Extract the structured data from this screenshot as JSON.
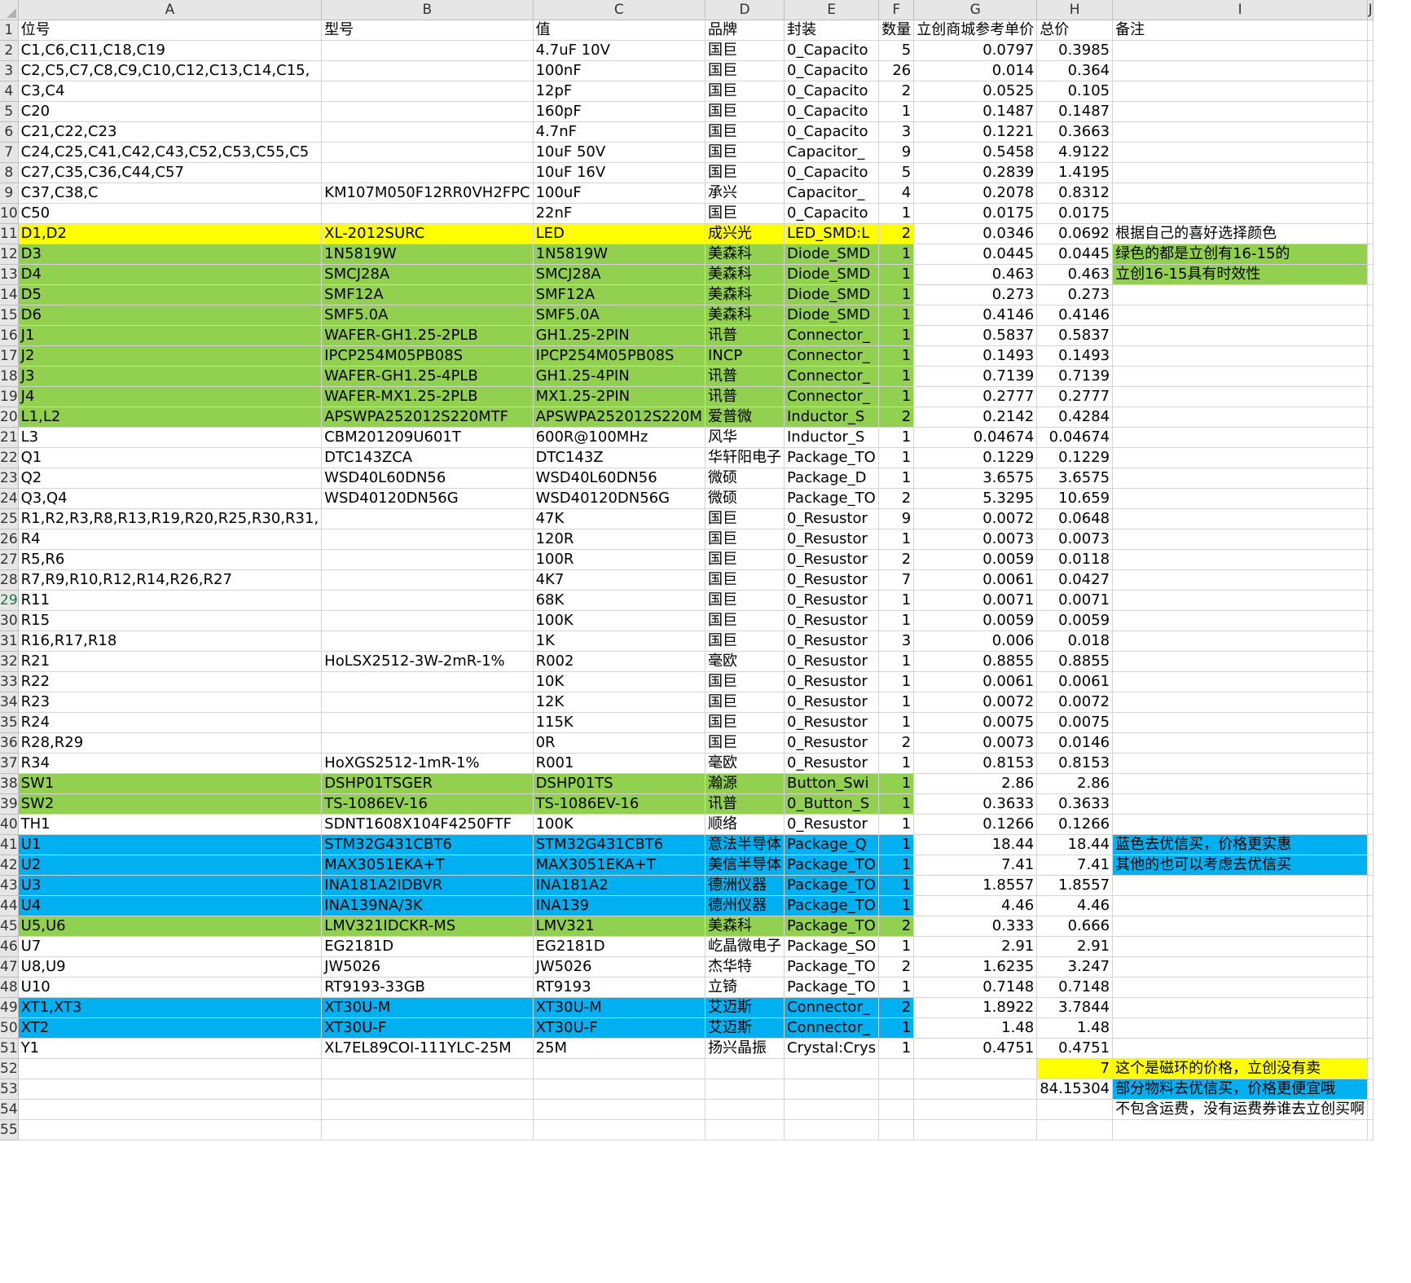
{
  "colors": {
    "yellow": "#ffff00",
    "green": "#92d050",
    "blue": "#00b0f0",
    "header_bg": "#e6e6e6"
  },
  "column_headers": [
    "A",
    "B",
    "C",
    "D",
    "E",
    "F",
    "G",
    "H",
    "I",
    "J"
  ],
  "rows": [
    {
      "r": 1,
      "cells": [
        "位号",
        "型号",
        "值",
        "品牌",
        "封装",
        "数量",
        "立创商城参考单价",
        "总价",
        "备注",
        ""
      ]
    },
    {
      "r": 2,
      "cells": [
        "C1,C6,C11,C18,C19",
        "",
        "4.7uF 10V",
        "国巨",
        "0_Capacito",
        "5",
        "0.0797",
        "0.3985",
        "",
        ""
      ]
    },
    {
      "r": 3,
      "cells": [
        "C2,C5,C7,C8,C9,C10,C12,C13,C14,C15,",
        "",
        "100nF",
        "国巨",
        "0_Capacito",
        "26",
        "0.014",
        "0.364",
        "",
        ""
      ]
    },
    {
      "r": 4,
      "cells": [
        "C3,C4",
        "",
        "12pF",
        "国巨",
        "0_Capacito",
        "2",
        "0.0525",
        "0.105",
        "",
        ""
      ]
    },
    {
      "r": 5,
      "cells": [
        "C20",
        "",
        "160pF",
        "国巨",
        "0_Capacito",
        "1",
        "0.1487",
        "0.1487",
        "",
        ""
      ]
    },
    {
      "r": 6,
      "cells": [
        "C21,C22,C23",
        "",
        "4.7nF",
        "国巨",
        "0_Capacito",
        "3",
        "0.1221",
        "0.3663",
        "",
        ""
      ]
    },
    {
      "r": 7,
      "cells": [
        "C24,C25,C41,C42,C43,C52,C53,C55,C5",
        "",
        "10uF 50V",
        "国巨",
        "Capacitor_",
        "9",
        "0.5458",
        "4.9122",
        "",
        ""
      ]
    },
    {
      "r": 8,
      "cells": [
        "C27,C35,C36,C44,C57",
        "",
        "10uF 16V",
        "国巨",
        "0_Capacito",
        "5",
        "0.2839",
        "1.4195",
        "",
        ""
      ]
    },
    {
      "r": 9,
      "cells": [
        "C37,C38,C",
        "KM107M050F12RR0VH2FPC",
        "100uF",
        "承兴",
        "Capacitor_",
        "4",
        "0.2078",
        "0.8312",
        "",
        ""
      ]
    },
    {
      "r": 10,
      "cells": [
        "C50",
        "",
        "22nF",
        "国巨",
        "0_Capacito",
        "1",
        "0.0175",
        "0.0175",
        "",
        ""
      ]
    },
    {
      "r": 11,
      "cells": [
        "D1,D2",
        "XL-2012SURC",
        "LED",
        "成兴光",
        "LED_SMD:L",
        "2",
        "0.0346",
        "0.0692",
        "根据自己的喜好选择颜色",
        ""
      ]
    },
    {
      "r": 12,
      "cells": [
        "D3",
        "1N5819W",
        "1N5819W",
        "美森科",
        "Diode_SMD",
        "1",
        "0.0445",
        "0.0445",
        "绿色的都是立创有16-15的",
        ""
      ]
    },
    {
      "r": 13,
      "cells": [
        "D4",
        "SMCJ28A",
        "SMCJ28A",
        "美森科",
        "Diode_SMD",
        "1",
        "0.463",
        "0.463",
        "立创16-15具有时效性",
        ""
      ]
    },
    {
      "r": 14,
      "cells": [
        "D5",
        "SMF12A",
        "SMF12A",
        "美森科",
        "Diode_SMD",
        "1",
        "0.273",
        "0.273",
        "",
        ""
      ]
    },
    {
      "r": 15,
      "cells": [
        "D6",
        "SMF5.0A",
        "SMF5.0A",
        "美森科",
        "Diode_SMD",
        "1",
        "0.4146",
        "0.4146",
        "",
        ""
      ]
    },
    {
      "r": 16,
      "cells": [
        "J1",
        "WAFER-GH1.25-2PLB",
        "GH1.25-2PIN",
        "讯普",
        "Connector_",
        "1",
        "0.5837",
        "0.5837",
        "",
        ""
      ]
    },
    {
      "r": 17,
      "cells": [
        "J2",
        "IPCP254M05PB08S",
        "IPCP254M05PB08S",
        "INCP",
        "Connector_",
        "1",
        "0.1493",
        "0.1493",
        "",
        ""
      ]
    },
    {
      "r": 18,
      "cells": [
        "J3",
        "WAFER-GH1.25-4PLB",
        "GH1.25-4PIN",
        "讯普",
        "Connector_",
        "1",
        "0.7139",
        "0.7139",
        "",
        ""
      ]
    },
    {
      "r": 19,
      "cells": [
        "J4",
        "WAFER-MX1.25-2PLB",
        "MX1.25-2PIN",
        "讯普",
        "Connector_",
        "1",
        "0.2777",
        "0.2777",
        "",
        ""
      ]
    },
    {
      "r": 20,
      "cells": [
        "L1,L2",
        "APSWPA252012S220MTF",
        "APSWPA252012S220M",
        "爱普微",
        "Inductor_S",
        "2",
        "0.2142",
        "0.4284",
        "",
        ""
      ]
    },
    {
      "r": 21,
      "cells": [
        "L3",
        "CBM201209U601T",
        "600R@100MHz",
        "风华",
        "Inductor_S",
        "1",
        "0.04674",
        "0.04674",
        "",
        ""
      ]
    },
    {
      "r": 22,
      "cells": [
        "Q1",
        "DTC143ZCA",
        "DTC143Z",
        "华轩阳电子",
        "Package_TO",
        "1",
        "0.1229",
        "0.1229",
        "",
        ""
      ]
    },
    {
      "r": 23,
      "cells": [
        "Q2",
        "WSD40L60DN56",
        "WSD40L60DN56",
        "微硕",
        "Package_D",
        "1",
        "3.6575",
        "3.6575",
        "",
        ""
      ]
    },
    {
      "r": 24,
      "cells": [
        "Q3,Q4",
        "WSD40120DN56G",
        "WSD40120DN56G",
        "微硕",
        "Package_TO",
        "2",
        "5.3295",
        "10.659",
        "",
        ""
      ]
    },
    {
      "r": 25,
      "cells": [
        "R1,R2,R3,R8,R13,R19,R20,R25,R30,R31,",
        "",
        "47K",
        "国巨",
        "0_Resustor",
        "9",
        "0.0072",
        "0.0648",
        "",
        ""
      ]
    },
    {
      "r": 26,
      "cells": [
        "R4",
        "",
        "120R",
        "国巨",
        "0_Resustor",
        "1",
        "0.0073",
        "0.0073",
        "",
        ""
      ]
    },
    {
      "r": 27,
      "cells": [
        "R5,R6",
        "",
        "100R",
        "国巨",
        "0_Resustor",
        "2",
        "0.0059",
        "0.0118",
        "",
        ""
      ]
    },
    {
      "r": 28,
      "cells": [
        "R7,R9,R10,R12,R14,R26,R27",
        "",
        "4K7",
        "国巨",
        "0_Resustor",
        "7",
        "0.0061",
        "0.0427",
        "",
        ""
      ]
    },
    {
      "r": 29,
      "cells": [
        "R11",
        "",
        "68K",
        "国巨",
        "0_Resustor",
        "1",
        "0.0071",
        "0.0071",
        "",
        ""
      ]
    },
    {
      "r": 30,
      "cells": [
        "R15",
        "",
        "100K",
        "国巨",
        "0_Resustor",
        "1",
        "0.0059",
        "0.0059",
        "",
        ""
      ]
    },
    {
      "r": 31,
      "cells": [
        "R16,R17,R18",
        "",
        "1K",
        "国巨",
        "0_Resustor",
        "3",
        "0.006",
        "0.018",
        "",
        ""
      ]
    },
    {
      "r": 32,
      "cells": [
        "R21",
        "HoLSX2512-3W-2mR-1%",
        "R002",
        "毫欧",
        "0_Resustor",
        "1",
        "0.8855",
        "0.8855",
        "",
        ""
      ]
    },
    {
      "r": 33,
      "cells": [
        "R22",
        "",
        "10K",
        "国巨",
        "0_Resustor",
        "1",
        "0.0061",
        "0.0061",
        "",
        ""
      ]
    },
    {
      "r": 34,
      "cells": [
        "R23",
        "",
        "12K",
        "国巨",
        "0_Resustor",
        "1",
        "0.0072",
        "0.0072",
        "",
        ""
      ]
    },
    {
      "r": 35,
      "cells": [
        "R24",
        "",
        "115K",
        "国巨",
        "0_Resustor",
        "1",
        "0.0075",
        "0.0075",
        "",
        ""
      ]
    },
    {
      "r": 36,
      "cells": [
        "R28,R29",
        "",
        "0R",
        "国巨",
        "0_Resustor",
        "2",
        "0.0073",
        "0.0146",
        "",
        ""
      ]
    },
    {
      "r": 37,
      "cells": [
        "R34",
        "HoXGS2512-1mR-1%",
        "R001",
        "毫欧",
        "0_Resustor",
        "1",
        "0.8153",
        "0.8153",
        "",
        ""
      ]
    },
    {
      "r": 38,
      "cells": [
        "SW1",
        "DSHP01TSGER",
        "DSHP01TS",
        "瀚源",
        "Button_Swi",
        "1",
        "2.86",
        "2.86",
        "",
        ""
      ]
    },
    {
      "r": 39,
      "cells": [
        "SW2",
        "TS-1086EV-16",
        "TS-1086EV-16",
        "讯普",
        "0_Button_S",
        "1",
        "0.3633",
        "0.3633",
        "",
        ""
      ]
    },
    {
      "r": 40,
      "cells": [
        "TH1",
        "SDNT1608X104F4250FTF",
        "100K",
        "顺络",
        "0_Resustor",
        "1",
        "0.1266",
        "0.1266",
        "",
        ""
      ]
    },
    {
      "r": 41,
      "cells": [
        "U1",
        "STM32G431CBT6",
        "STM32G431CBT6",
        "意法半导体",
        "Package_Q",
        "1",
        "18.44",
        "18.44",
        "蓝色去优信买，价格更实惠",
        ""
      ]
    },
    {
      "r": 42,
      "cells": [
        "U2",
        "MAX3051EKA+T",
        "MAX3051EKA+T",
        "美信半导体",
        "Package_TO",
        "1",
        "7.41",
        "7.41",
        "其他的也可以考虑去优信买",
        ""
      ]
    },
    {
      "r": 43,
      "cells": [
        "U3",
        "INA181A2IDBVR",
        "INA181A2",
        "德洲仪器",
        "Package_TO",
        "1",
        "1.8557",
        "1.8557",
        "",
        ""
      ]
    },
    {
      "r": 44,
      "cells": [
        "U4",
        "INA139NA/3K",
        "INA139",
        "德州仪器",
        "Package_TO",
        "1",
        "4.46",
        "4.46",
        "",
        ""
      ]
    },
    {
      "r": 45,
      "cells": [
        "U5,U6",
        "LMV321IDCKR-MS",
        "LMV321",
        "美森科",
        "Package_TO",
        "2",
        "0.333",
        "0.666",
        "",
        ""
      ]
    },
    {
      "r": 46,
      "cells": [
        "U7",
        "EG2181D",
        "EG2181D",
        "屹晶微电子",
        "Package_SO",
        "1",
        "2.91",
        "2.91",
        "",
        ""
      ]
    },
    {
      "r": 47,
      "cells": [
        "U8,U9",
        "JW5026",
        "JW5026",
        "杰华特",
        "Package_TO",
        "2",
        "1.6235",
        "3.247",
        "",
        ""
      ]
    },
    {
      "r": 48,
      "cells": [
        "U10",
        "RT9193-33GB",
        "RT9193",
        "立锜",
        "Package_TO",
        "1",
        "0.7148",
        "0.7148",
        "",
        ""
      ]
    },
    {
      "r": 49,
      "cells": [
        "XT1,XT3",
        "XT30U-M",
        "XT30U-M",
        "艾迈斯",
        "Connector_",
        "2",
        "1.8922",
        "3.7844",
        "",
        ""
      ]
    },
    {
      "r": 50,
      "cells": [
        "XT2",
        "XT30U-F",
        "XT30U-F",
        "艾迈斯",
        "Connector_",
        "1",
        "1.48",
        "1.48",
        "",
        ""
      ]
    },
    {
      "r": 51,
      "cells": [
        "Y1",
        "XL7EL89COI-111YLC-25M",
        "25M",
        "扬兴晶振",
        "Crystal:Crys",
        "1",
        "0.4751",
        "0.4751",
        "",
        ""
      ]
    },
    {
      "r": 52,
      "cells": [
        "",
        "",
        "",
        "",
        "",
        "",
        "",
        "7",
        "这个是磁环的价格，立创没有卖",
        ""
      ]
    },
    {
      "r": 53,
      "cells": [
        "",
        "",
        "",
        "",
        "",
        "",
        "",
        "84.15304",
        "部分物料去优信买，价格更便宜哦",
        ""
      ]
    },
    {
      "r": 54,
      "cells": [
        "",
        "",
        "",
        "",
        "",
        "",
        "",
        "",
        "不包含运费，没有运费券谁去立创买啊",
        ""
      ]
    },
    {
      "r": 55,
      "cells": [
        "",
        "",
        "",
        "",
        "",
        "",
        "",
        "",
        "",
        ""
      ]
    }
  ],
  "selected_row": 29
}
